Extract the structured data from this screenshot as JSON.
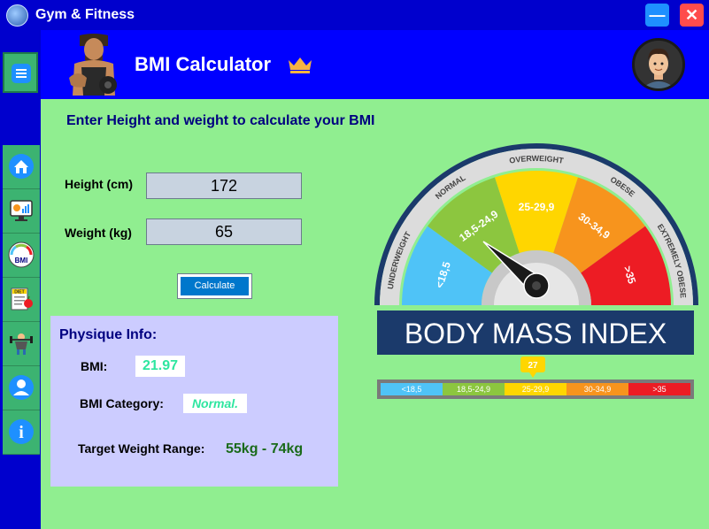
{
  "window": {
    "title": "Gym & Fitness",
    "minimize": "—",
    "close": "✕"
  },
  "header": {
    "title": "BMI Calculator"
  },
  "sidebar": {
    "menu_icon": "hamburger-menu-icon",
    "items": [
      {
        "icon": "home-icon"
      },
      {
        "icon": "dashboard-icon"
      },
      {
        "icon": "bmi-gauge-icon",
        "text": "BMI"
      },
      {
        "icon": "diet-plan-icon",
        "text": "DIET"
      },
      {
        "icon": "workout-icon"
      },
      {
        "icon": "user-profile-icon"
      },
      {
        "icon": "info-icon",
        "text": "i"
      }
    ]
  },
  "form": {
    "prompt": "Enter Height and weight to calculate your BMI",
    "height_label": "Height (cm)",
    "height_value": "172",
    "weight_label": "Weight (kg)",
    "weight_value": "65",
    "calculate_label": "Calculate"
  },
  "physique": {
    "title": "Physique Info:",
    "bmi_label": "BMI:",
    "bmi_value": "21.97",
    "category_label": "BMI Category:",
    "category_value": "Normal.",
    "target_label": "Target Weight Range:",
    "target_value": "55kg - 74kg"
  },
  "gauge": {
    "banner": "BODY MASS INDEX",
    "marker": "27",
    "segments": [
      {
        "name": "UNDERWEIGHT",
        "range": "<18,5",
        "color": "#4fc3f7"
      },
      {
        "name": "NORMAL",
        "range": "18,5-24,9",
        "color": "#8cc63f"
      },
      {
        "name": "OVERWEIGHT",
        "range": "25-29,9",
        "color": "#ffd600"
      },
      {
        "name": "OBESE",
        "range": "30-34,9",
        "color": "#f7941d"
      },
      {
        "name": "EXTREMELY OBESE",
        "range": ">35",
        "color": "#ed1c24"
      }
    ],
    "needle_segment": 1
  },
  "colors": {
    "app_bg": "#90ee90",
    "titlebar": "#0000cd",
    "header": "#0000ff",
    "panel": "#ccccff",
    "accent_green": "#3cb371"
  }
}
